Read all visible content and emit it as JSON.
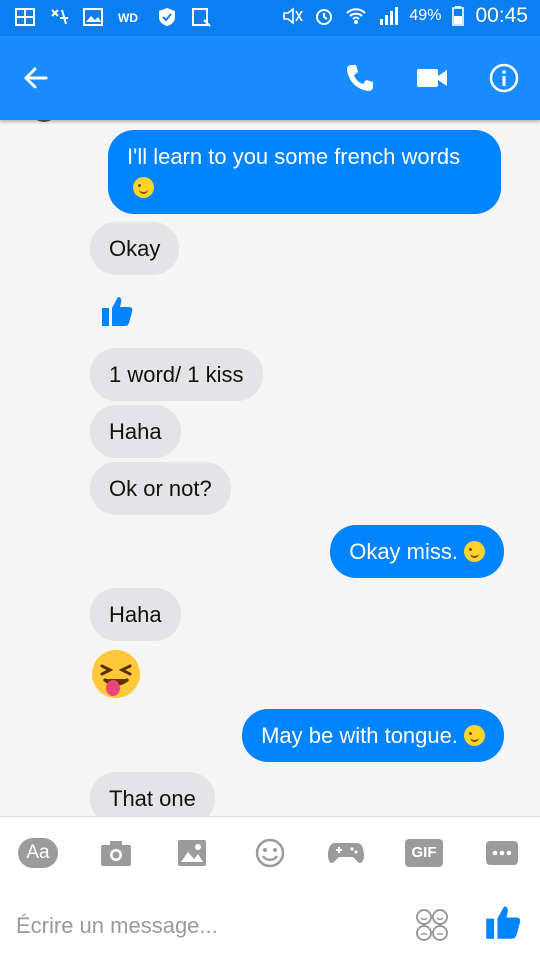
{
  "status_bar": {
    "battery": "49%",
    "time": "00:45"
  },
  "header": {
    "back_icon": "arrow-left-icon",
    "actions": [
      "phone-icon",
      "video-camera-icon",
      "info-icon"
    ]
  },
  "messages": [
    {
      "dir": "out",
      "text": "I'll learn to you some french words",
      "emoji": "wink"
    },
    {
      "dir": "in",
      "text": "Okay"
    },
    {
      "dir": "in",
      "type": "thumbs-up"
    },
    {
      "dir": "in",
      "text": "1 word/ 1 kiss"
    },
    {
      "dir": "in",
      "text": "Haha"
    },
    {
      "dir": "in",
      "text": "Ok or not?"
    },
    {
      "dir": "out",
      "text": "Okay miss.",
      "emoji": "wink"
    },
    {
      "dir": "in",
      "text": "Haha"
    },
    {
      "dir": "in",
      "type": "emoji",
      "emoji": "tongue-out"
    },
    {
      "dir": "out",
      "text": "May be with tongue.",
      "emoji": "wink"
    },
    {
      "dir": "in",
      "text": "That one"
    }
  ],
  "composer": {
    "tools": [
      "Aa",
      "camera-icon",
      "image-icon",
      "emoji-icon",
      "gamepad-icon",
      "GIF",
      "more-icon"
    ],
    "aa_label": "Aa",
    "gif_label": "GIF",
    "placeholder": "Écrire un message...",
    "reactions_icon": "stickers-icon",
    "send_icon": "thumbs-up-icon"
  },
  "colors": {
    "header": "#1a8cff",
    "statusbar": "#0a7ff0",
    "outgoing": "#0084ff",
    "incoming": "#e4e4e6",
    "icon_gray": "#9b9b9b"
  }
}
